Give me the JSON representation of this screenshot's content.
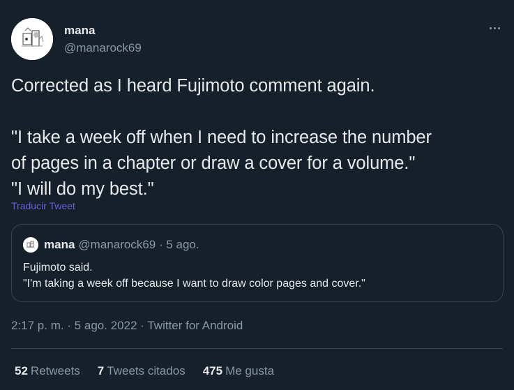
{
  "author": {
    "name": "mana",
    "handle": "@manarock69"
  },
  "tweet": {
    "lines": [
      "Corrected as I heard Fujimoto comment again.",
      "\"I take a week off when I need to increase the number",
      "of pages in a chapter or draw a cover for a volume.\"",
      "\"I will do my best.\""
    ],
    "translate_label": "Traducir Tweet"
  },
  "quoted": {
    "name": "mana",
    "meta": "@manarock69 · 5 ago.",
    "lines": [
      "Fujimoto said.",
      "\"I'm taking a week off because I want to draw color pages and cover.\""
    ]
  },
  "meta": {
    "time": "2:17 p. m.",
    "separator": " · ",
    "date": "5 ago. 2022",
    "source": "Twitter for Android"
  },
  "stats": {
    "retweets_count": "52",
    "retweets_label": "Retweets",
    "quotes_count": "7",
    "quotes_label": "Tweets citados",
    "likes_count": "475",
    "likes_label": "Me gusta"
  },
  "colors": {
    "background": "#15202b",
    "text": "#e7e9ea",
    "secondary_text": "#8b98a5",
    "link": "#6a5fd6",
    "border": "#38444d"
  },
  "icons": {
    "more": "more-icon"
  }
}
